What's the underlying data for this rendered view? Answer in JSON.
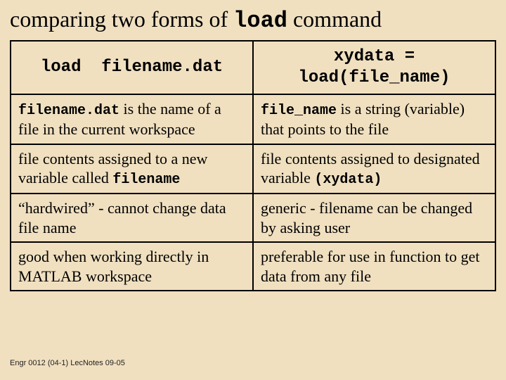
{
  "title_parts": {
    "pre": "comparing two forms of ",
    "code": "load",
    "post": " command"
  },
  "headers": {
    "left_1": "load",
    "left_gap": "  ",
    "left_2": "filename.dat",
    "right_line1": "xydata =",
    "right_line2": "load(file_name)"
  },
  "rows": [
    {
      "left": {
        "code": "filename.dat",
        "post": " is the name of a file in the current workspace"
      },
      "right": {
        "code": "file_name",
        "post": " is a string (variable) that points to the file"
      }
    },
    {
      "left": {
        "pre": "file contents assigned to a new variable called ",
        "code": "filename"
      },
      "right": {
        "pre": "file contents assigned to designated variable ",
        "code": "(xydata)"
      }
    },
    {
      "left": {
        "text": "“hardwired” - cannot change data file name"
      },
      "right": {
        "text": "generic - filename can be changed by asking user"
      }
    },
    {
      "left": {
        "text": "good when working directly in MATLAB workspace"
      },
      "right": {
        "text": "preferable for use in function to get data from any file"
      }
    }
  ],
  "footer": "Engr 0012 (04-1) LecNotes 09-05"
}
